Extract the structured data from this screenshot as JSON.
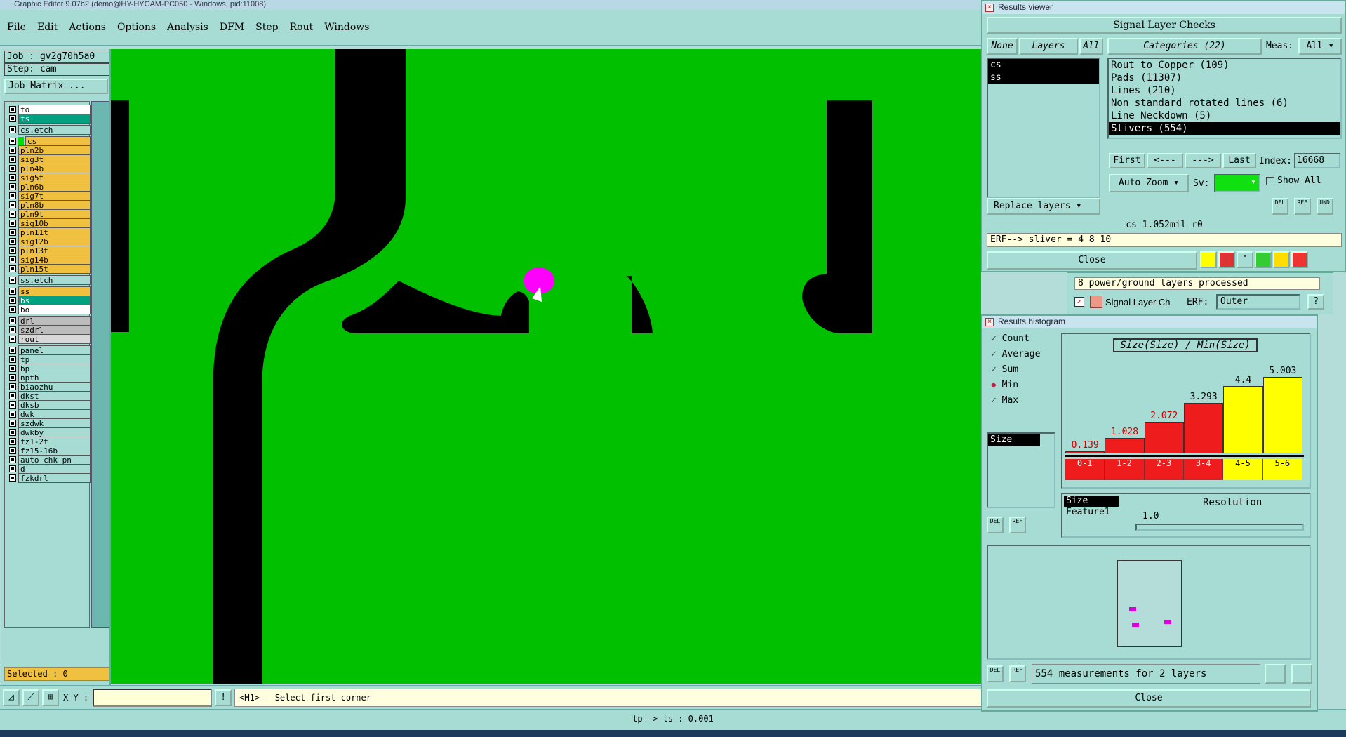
{
  "window": {
    "title": "Graphic Editor 9.07b2 (demo@HY-HYCAM-PC050 - Windows, pid:11008)"
  },
  "menu": [
    "File",
    "Edit",
    "Actions",
    "Options",
    "Analysis",
    "DFM",
    "Step",
    "Rout",
    "Windows"
  ],
  "job": {
    "job": "Job : gv2g70h5a0",
    "step": "Step: cam",
    "matrix_button": "Job Matrix ..."
  },
  "layers": [
    {
      "name": "to",
      "color": "#ffffff"
    },
    {
      "name": "ts",
      "color": "#00a080",
      "text": "#fff"
    },
    {
      "name": "cs.etch",
      "color": "#a6dcd4",
      "gap": true
    },
    {
      "name": "cs",
      "color": "#f0c040",
      "active": true,
      "gap": true
    },
    {
      "name": "pln2b",
      "color": "#f0c040"
    },
    {
      "name": "sig3t",
      "color": "#f0c040"
    },
    {
      "name": "pln4b",
      "color": "#f0c040"
    },
    {
      "name": "sig5t",
      "color": "#f0c040"
    },
    {
      "name": "pln6b",
      "color": "#f0c040"
    },
    {
      "name": "sig7t",
      "color": "#f0c040"
    },
    {
      "name": "pln8b",
      "color": "#f0c040"
    },
    {
      "name": "pln9t",
      "color": "#f0c040"
    },
    {
      "name": "sig10b",
      "color": "#f0c040"
    },
    {
      "name": "pln11t",
      "color": "#f0c040"
    },
    {
      "name": "sig12b",
      "color": "#f0c040"
    },
    {
      "name": "pln13t",
      "color": "#f0c040"
    },
    {
      "name": "sig14b",
      "color": "#f0c040"
    },
    {
      "name": "pln15t",
      "color": "#f0c040"
    },
    {
      "name": "ss.etch",
      "color": "#a6dcd4",
      "gap": true
    },
    {
      "name": "ss",
      "color": "#f0c040",
      "gap": true
    },
    {
      "name": "bs",
      "color": "#00a080",
      "text": "#fff"
    },
    {
      "name": "bo",
      "color": "#ffffff"
    },
    {
      "name": "drl",
      "color": "#bcbcbc",
      "gap": true
    },
    {
      "name": "szdrl",
      "color": "#bcbcbc"
    },
    {
      "name": "rout",
      "color": "#d8d8d8"
    },
    {
      "name": "panel",
      "color": "#a6dcd4",
      "gap": true
    },
    {
      "name": "tp",
      "color": "#a6dcd4"
    },
    {
      "name": "bp",
      "color": "#a6dcd4"
    },
    {
      "name": "npth",
      "color": "#a6dcd4"
    },
    {
      "name": "biaozhu",
      "color": "#a6dcd4"
    },
    {
      "name": "dkst",
      "color": "#a6dcd4"
    },
    {
      "name": "dksb",
      "color": "#a6dcd4"
    },
    {
      "name": "dwk",
      "color": "#a6dcd4"
    },
    {
      "name": "szdwk",
      "color": "#a6dcd4"
    },
    {
      "name": "dwkby",
      "color": "#a6dcd4"
    },
    {
      "name": "fz1-2t",
      "color": "#a6dcd4"
    },
    {
      "name": "fz15-16b",
      "color": "#a6dcd4"
    },
    {
      "name": "auto_chk_pn",
      "color": "#a6dcd4"
    },
    {
      "name": "d",
      "color": "#a6dcd4"
    },
    {
      "name": "fzkdrl",
      "color": "#a6dcd4"
    }
  ],
  "selected": "Selected : 0",
  "coords": {
    "label": "X Y :",
    "value": ""
  },
  "hint": "<M1> - Select first corner",
  "status": "tp -> ts : 0.001",
  "results_viewer": {
    "title": "Results viewer",
    "header": "Signal Layer Checks",
    "btn_none": "None",
    "btn_layers": "Layers",
    "btn_all": "All",
    "categories_label": "Categories (22)",
    "meas_label": "Meas:",
    "meas_value": "All",
    "layer_list": [
      "cs",
      "ss"
    ],
    "categories": [
      "Rout to Copper (109)",
      "Pads (11307)",
      "Lines (210)",
      "Non standard rotated lines (6)",
      "Line Neckdown (5)",
      "Slivers (554)"
    ],
    "selected_category": 5,
    "nav": {
      "first": "First",
      "prev": "<---",
      "next": "--->",
      "last": "Last",
      "index_label": "Index:",
      "index_value": "16668"
    },
    "auto_zoom": "Auto Zoom",
    "sv_label": "Sv:",
    "show_all": "Show All",
    "replace_layers": "Replace layers",
    "info": "cs 1.052mil  r0",
    "erf": "ERF--> sliver = 4 8 10",
    "close": "Close"
  },
  "background_dialog": {
    "msg": "8 power/ground layers processed",
    "item": "Signal Layer Ch",
    "erf_label": "ERF:",
    "erf_value": "Outer"
  },
  "histogram": {
    "title": "Results histogram",
    "options": [
      {
        "label": "Count",
        "checked": false
      },
      {
        "label": "Average",
        "checked": false
      },
      {
        "label": "Sum",
        "checked": false
      },
      {
        "label": "Min",
        "checked": true
      },
      {
        "label": "Max",
        "checked": false
      }
    ],
    "chart_title": "Size(Size) / Min(Size)",
    "attribute_list": [
      "Size"
    ],
    "measure_list": [
      "Size",
      "Feature1"
    ],
    "resolution_label": "Resolution",
    "resolution_value": "1.0",
    "footer_msg": "554 measurements for 2 layers",
    "close": "Close",
    "del": "DEL",
    "ref": "REF"
  },
  "chart_data": {
    "type": "bar",
    "title": "Size(Size) / Min(Size)",
    "categories": [
      "0-1",
      "1-2",
      "2-3",
      "3-4",
      "4-5",
      "5-6"
    ],
    "values": [
      0.139,
      1.028,
      2.072,
      3.293,
      4.4,
      5.003
    ],
    "value_labels": [
      "0.139",
      "1.028",
      "2.072",
      "3.293",
      "4.4",
      "5.003"
    ],
    "colors": [
      "#ee1c1c",
      "#ee1c1c",
      "#ee1c1c",
      "#ee1c1c",
      "#ffff00",
      "#ffff00"
    ],
    "label_colors": [
      "#cc0000",
      "#cc0000",
      "#cc0000",
      "#000000",
      "#000000",
      "#000000"
    ],
    "ylim": [
      0,
      5.5
    ]
  },
  "colors": {
    "canvas": "#00c000",
    "trace": "#000000",
    "highlight": "#ff00ff",
    "panel": "#a6dcd4"
  }
}
